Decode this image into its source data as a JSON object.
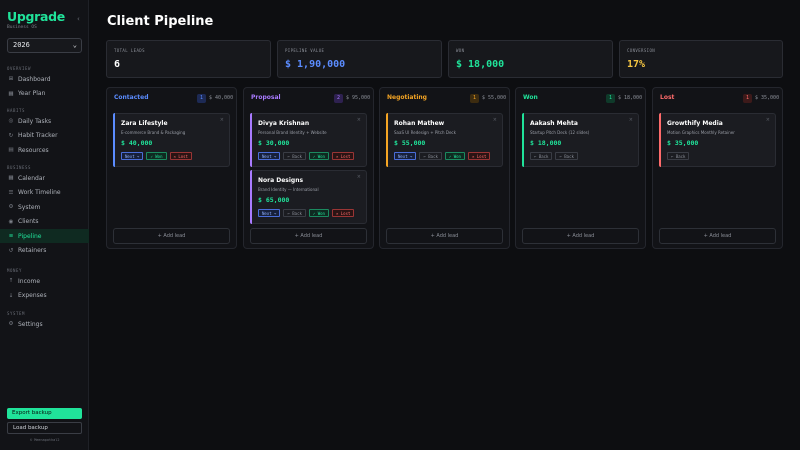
{
  "app": {
    "logo": "Upgrade",
    "workspace": "Business OS",
    "collapse_icon": "chevron-left"
  },
  "year_select": {
    "value": "2026"
  },
  "nav": {
    "sections": [
      {
        "label": "OVERVIEW",
        "items": [
          {
            "label": "Dashboard",
            "icon": "grid-icon"
          },
          {
            "label": "Year Plan",
            "icon": "calendar-icon"
          }
        ]
      },
      {
        "label": "HABITS",
        "items": [
          {
            "label": "Daily Tasks",
            "icon": "check-circle-icon"
          },
          {
            "label": "Habit Tracker",
            "icon": "repeat-icon"
          },
          {
            "label": "Resources",
            "icon": "book-icon"
          }
        ]
      },
      {
        "label": "BUSINESS",
        "items": [
          {
            "label": "Calendar",
            "icon": "calendar-icon"
          },
          {
            "label": "Work Timeline",
            "icon": "timeline-icon"
          },
          {
            "label": "System",
            "icon": "gear-icon"
          },
          {
            "label": "Clients",
            "icon": "users-icon"
          },
          {
            "label": "Pipeline",
            "icon": "pipeline-icon",
            "active": true
          },
          {
            "label": "Retainers",
            "icon": "refresh-icon"
          }
        ]
      },
      {
        "label": "MONEY",
        "items": [
          {
            "label": "Income",
            "icon": "arrow-up-icon"
          },
          {
            "label": "Expenses",
            "icon": "arrow-down-icon"
          }
        ]
      },
      {
        "label": "SYSTEM",
        "items": [
          {
            "label": "Settings",
            "icon": "gear-icon"
          }
        ]
      }
    ]
  },
  "footer": {
    "export_label": "Export backup",
    "load_label": "Load backup",
    "credit": "© Meenapothal2"
  },
  "page": {
    "title": "Client Pipeline"
  },
  "stats": [
    {
      "label": "TOTAL LEADS",
      "value": "6",
      "color": "#ffffff"
    },
    {
      "label": "PIPELINE VALUE",
      "value": "$ 1,90,000",
      "color": "#5b8cff"
    },
    {
      "label": "WON",
      "value": "$ 18,000",
      "color": "#20e39a"
    },
    {
      "label": "CONVERSION",
      "value": "17%",
      "color": "#f5c542"
    }
  ],
  "columns": [
    {
      "title": "Contacted",
      "count": "1",
      "total": "$ 40,000",
      "color": "#5b8cff",
      "count_bg": "#1d2a55",
      "cards": [
        {
          "name": "Zara Lifestyle",
          "desc": "E-commerce Brand & Packaging",
          "amount": "$ 40,000",
          "actions": [
            "Next →",
            "✓ Won",
            "✕ Lost"
          ]
        }
      ]
    },
    {
      "title": "Proposal",
      "count": "2",
      "total": "$ 95,000",
      "color": "#a97bff",
      "count_bg": "#2e2150",
      "cards": [
        {
          "name": "Divya Krishnan",
          "desc": "Personal Brand Identity + Website",
          "amount": "$ 30,000",
          "actions": [
            "Next →",
            "← Back",
            "✓ Won",
            "✕ Lost"
          ]
        },
        {
          "name": "Nora Designs",
          "desc": "Brand Identity — International",
          "amount": "$ 65,000",
          "actions": [
            "Next →",
            "← Back",
            "✓ Won",
            "✕ Lost"
          ]
        }
      ]
    },
    {
      "title": "Negotiating",
      "count": "1",
      "total": "$ 55,000",
      "color": "#f5a524",
      "count_bg": "#3d2c10",
      "cards": [
        {
          "name": "Rohan Mathew",
          "desc": "SaaS UI Redesign + Pitch Deck",
          "amount": "$ 55,000",
          "actions": [
            "Next →",
            "← Back",
            "✓ Won",
            "✕ Lost"
          ]
        }
      ]
    },
    {
      "title": "Won",
      "count": "1",
      "total": "$ 18,000",
      "color": "#20e39a",
      "count_bg": "#0f3a2a",
      "cards": [
        {
          "name": "Aakash Mehta",
          "desc": "Startup Pitch Deck (12 slides)",
          "amount": "$ 18,000",
          "actions": [
            "← Back",
            "← Back"
          ]
        }
      ]
    },
    {
      "title": "Lost",
      "count": "1",
      "total": "$ 35,000",
      "color": "#ff6b6b",
      "count_bg": "#3d1a1a",
      "cards": [
        {
          "name": "Growthify Media",
          "desc": "Motion Graphics Monthly Retainer",
          "amount": "$ 35,000",
          "actions": [
            "← Back"
          ]
        }
      ]
    }
  ],
  "add_lead_label": "+ Add lead"
}
